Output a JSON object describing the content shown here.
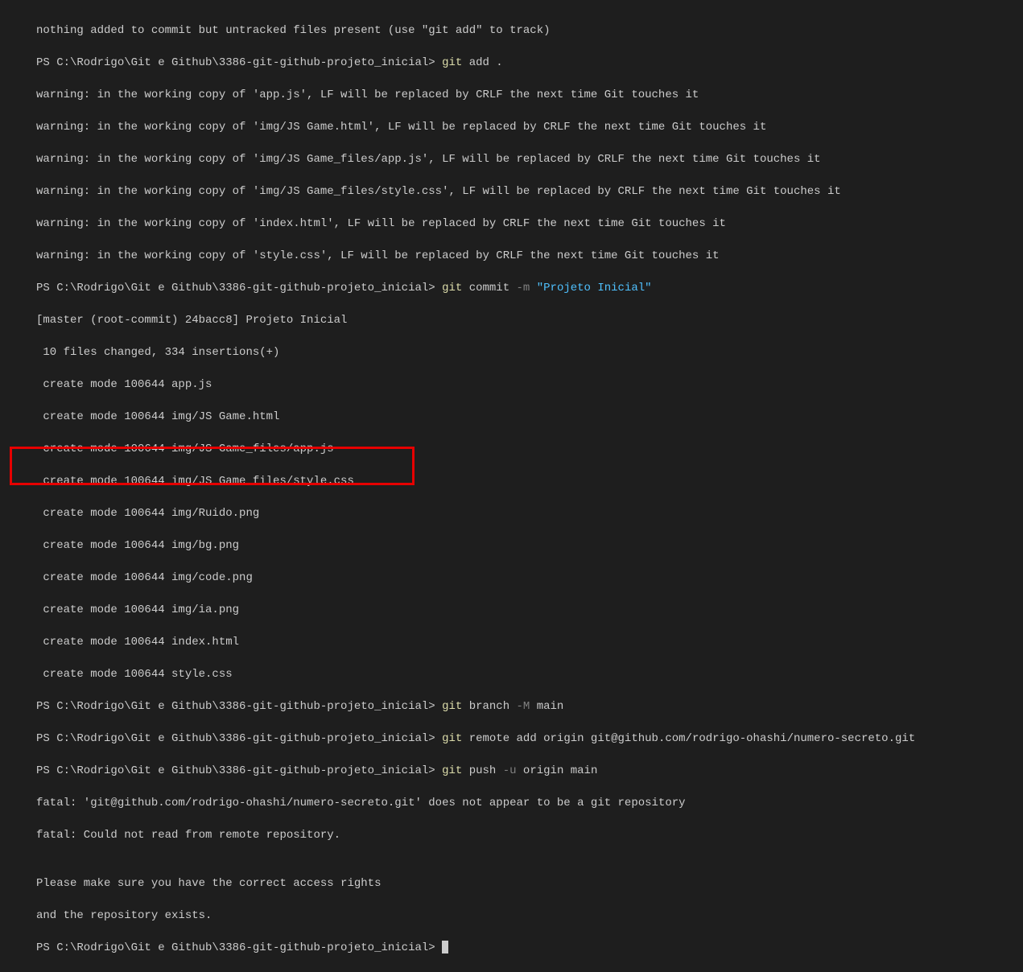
{
  "lines": {
    "l0": "nothing added to commit but untracked files present (use \"git add\" to track)",
    "l1_prompt": "PS C:\\Rodrigo\\Git e Github\\3386-git-github-projeto_inicial> ",
    "l1_cmd": "git ",
    "l1_rest": "add .",
    "l2": "warning: in the working copy of 'app.js', LF will be replaced by CRLF the next time Git touches it",
    "l3": "warning: in the working copy of 'img/JS Game.html', LF will be replaced by CRLF the next time Git touches it",
    "l4": "warning: in the working copy of 'img/JS Game_files/app.js', LF will be replaced by CRLF the next time Git touches it",
    "l5": "warning: in the working copy of 'img/JS Game_files/style.css', LF will be replaced by CRLF the next time Git touches it",
    "l6": "warning: in the working copy of 'index.html', LF will be replaced by CRLF the next time Git touches it",
    "l7": "warning: in the working copy of 'style.css', LF will be replaced by CRLF the next time Git touches it",
    "l8_prompt": "PS C:\\Rodrigo\\Git e Github\\3386-git-github-projeto_inicial> ",
    "l8_cmd": "git ",
    "l8_sub": "commit ",
    "l8_flag": "-m ",
    "l8_str": "\"Projeto Inicial\"",
    "l9": "[master (root-commit) 24bacc8] Projeto Inicial",
    "l10": " 10 files changed, 334 insertions(+)",
    "l11": " create mode 100644 app.js",
    "l12": " create mode 100644 img/JS Game.html",
    "l13": " create mode 100644 img/JS Game_files/app.js",
    "l14": " create mode 100644 img/JS Game_files/style.css",
    "l15": " create mode 100644 img/Ruido.png",
    "l16": " create mode 100644 img/bg.png",
    "l17": " create mode 100644 img/code.png",
    "l18": " create mode 100644 img/ia.png",
    "l19": " create mode 100644 index.html",
    "l20": " create mode 100644 style.css",
    "l21_prompt": "PS C:\\Rodrigo\\Git e Github\\3386-git-github-projeto_inicial> ",
    "l21_cmd": "git ",
    "l21_sub": "branch ",
    "l21_flag": "-M",
    "l21_rest": " main",
    "l22_prompt": "PS C:\\Rodrigo\\Git e Github\\3386-git-github-projeto_inicial> ",
    "l22_cmd": "git ",
    "l22_rest": "remote add origin git@github.com/rodrigo-ohashi/numero-secreto.git",
    "l23_prompt": "PS C:\\Rodrigo\\Git e Github\\3386-git-github-projeto_inicial> ",
    "l23_cmd": "git ",
    "l23_sub": "push ",
    "l23_flag": "-u",
    "l23_rest": " origin main",
    "l24": "fatal: 'git@github.com/rodrigo-ohashi/numero-secreto.git' does not appear to be a git repository",
    "l25": "fatal: Could not read from remote repository.",
    "l26": "",
    "l27": "Please make sure you have the correct access rights",
    "l28": "and the repository exists.",
    "l29_prompt": "PS C:\\Rodrigo\\Git e Github\\3386-git-github-projeto_inicial> "
  }
}
